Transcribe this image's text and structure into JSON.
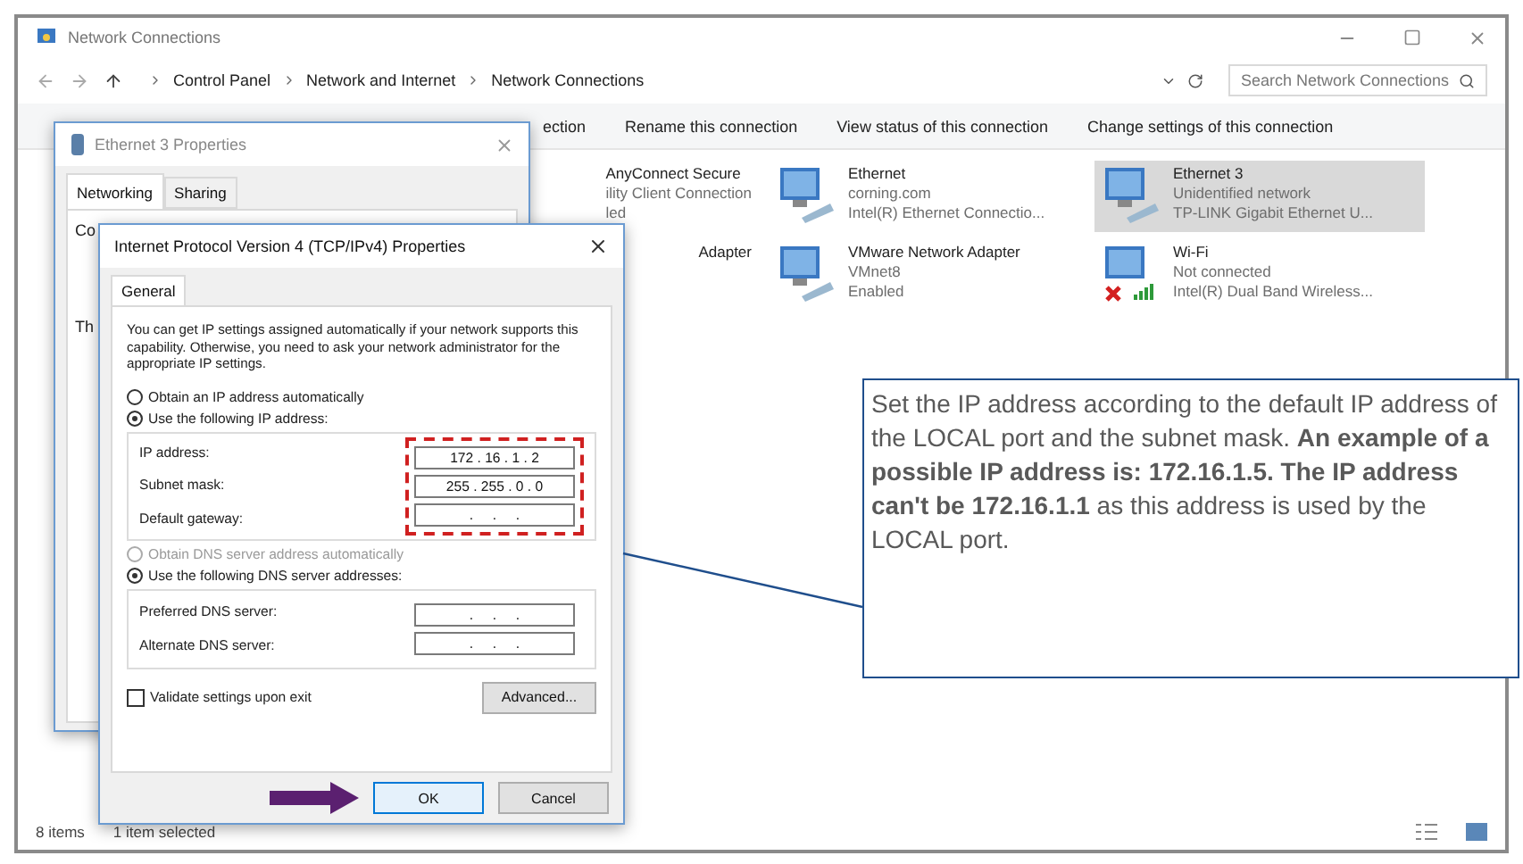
{
  "window": {
    "title": "Network Connections"
  },
  "address": {
    "path": [
      "Control Panel",
      "Network and Internet",
      "Network Connections"
    ],
    "search": {
      "placeholder": "Search Network Connections"
    }
  },
  "toolbar": [
    "ection",
    "Rename this connection",
    "View status of this connection",
    "Change settings of this connection"
  ],
  "connections": [
    {
      "kind": "partial",
      "lines": [
        "AnyConnect Secure",
        "ility Client Connection",
        "led"
      ],
      "selected": false
    },
    {
      "kind": "wired",
      "lines": [
        "Ethernet",
        "corning.com",
        "Intel(R) Ethernet Connectio..."
      ],
      "selected": false
    },
    {
      "kind": "wired",
      "lines": [
        "Ethernet 3",
        "Unidentified network",
        "TP-LINK Gigabit Ethernet U..."
      ],
      "selected": true
    },
    {
      "kind": "partial",
      "lines": [
        "Adapter"
      ],
      "selected": false
    },
    {
      "kind": "wired",
      "lines": [
        "VMware Network Adapter",
        "VMnet8",
        "Enabled"
      ],
      "selected": false
    },
    {
      "kind": "wireless",
      "lines": [
        "Wi-Fi",
        "Not connected",
        "Intel(R) Dual Band Wireless..."
      ],
      "selected": false
    }
  ],
  "status_bar": {
    "count": "8 items",
    "selection": "1 item selected"
  },
  "properties_dialog": {
    "title": "Ethernet 3 Properties",
    "tabs": [
      {
        "label": "Networking",
        "selected": true
      },
      {
        "label": "Sharing",
        "selected": false
      }
    ],
    "fragments": [
      "Co",
      "Th"
    ]
  },
  "ipv4_dialog": {
    "title": "Internet Protocol Version 4 (TCP/IPv4) Properties",
    "tabs": [
      {
        "label": "General",
        "selected": true
      }
    ],
    "intro": "You can get IP settings assigned automatically if your network supports this capability. Otherwise, you need to ask your network administrator for the appropriate IP settings.",
    "ip_mode": [
      {
        "label": "Obtain an IP address automatically",
        "selected": false,
        "disabled": false
      },
      {
        "label": "Use the following IP address:",
        "selected": true,
        "disabled": false
      }
    ],
    "ip_fields": [
      {
        "label": "IP address:",
        "value": "172 . 16 . 1 . 2"
      },
      {
        "label": "Subnet mask:",
        "value": "255 . 255 . 0 . 0"
      },
      {
        "label": "Default gateway:",
        "value": ".     .     ."
      }
    ],
    "dns_mode": [
      {
        "label": "Obtain DNS server address automatically",
        "selected": false,
        "disabled": true
      },
      {
        "label": "Use the following DNS server addresses:",
        "selected": true,
        "disabled": false
      }
    ],
    "dns_fields": [
      {
        "label": "Preferred DNS server:",
        "value": ".     .     ."
      },
      {
        "label": "Alternate DNS server:",
        "value": ".     .     ."
      }
    ],
    "validate": {
      "label": "Validate settings upon exit",
      "checked": false
    },
    "advanced": "Advanced...",
    "ok": "OK",
    "cancel": "Cancel"
  },
  "callout": {
    "text": "Set the IP address according to the default IP address of the LOCAL port and the subnet mask. **An example of a possible IP address is: 172.16.1.5. The IP address can't be 172.16.1.1** as this address is used by the LOCAL port."
  }
}
